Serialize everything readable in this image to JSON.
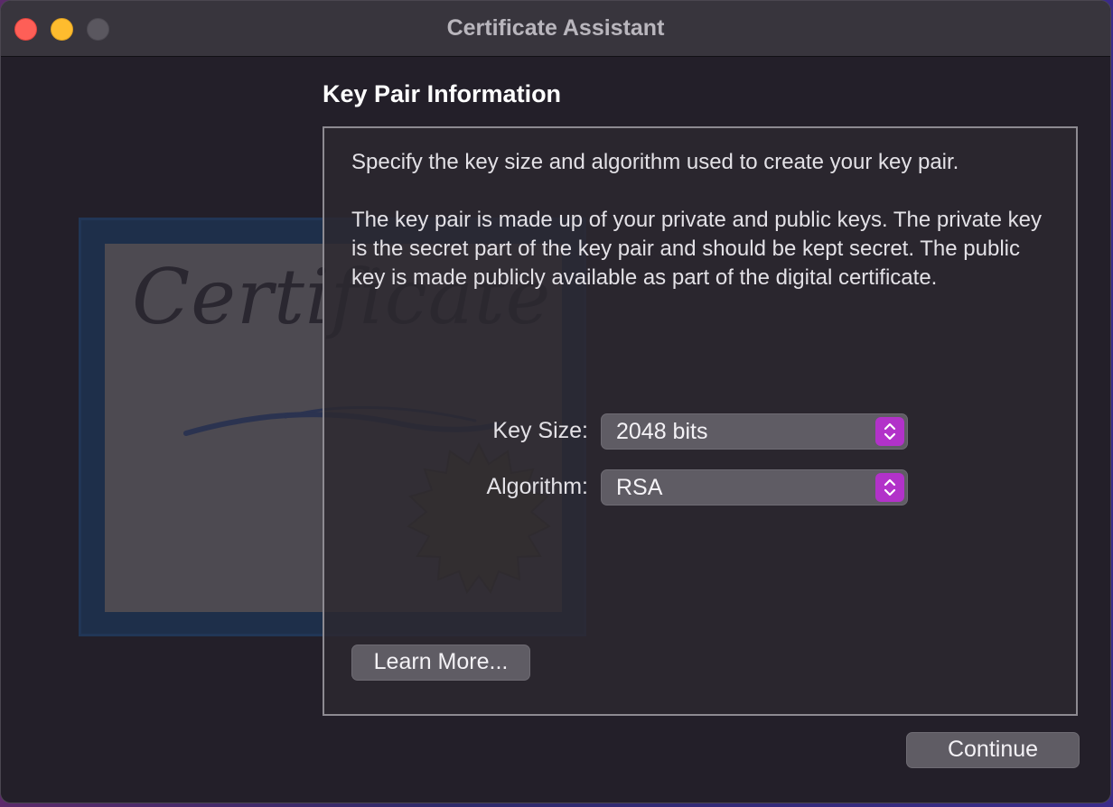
{
  "window": {
    "title": "Certificate Assistant"
  },
  "artwork": {
    "word": "Certificate"
  },
  "section": {
    "title": "Key Pair Information"
  },
  "panel": {
    "intro": "Specify the key size and algorithm used to create your key pair.",
    "description": "The key pair is made up of your private and public keys. The private key is the secret part of the key pair and should be kept secret. The public key is made publicly available as part of the digital certificate."
  },
  "form": {
    "key_size": {
      "label": "Key Size:",
      "value": "2048 bits"
    },
    "algorithm": {
      "label": "Algorithm:",
      "value": "RSA"
    }
  },
  "buttons": {
    "learn_more": "Learn More...",
    "continue": "Continue"
  },
  "colors": {
    "accent": "#b232c9",
    "close": "#fe5f57",
    "minimize": "#febc2e",
    "zoom_disabled": "#5a575f"
  },
  "icons": {
    "popup_arrows": "chevron-up-down-icon"
  }
}
